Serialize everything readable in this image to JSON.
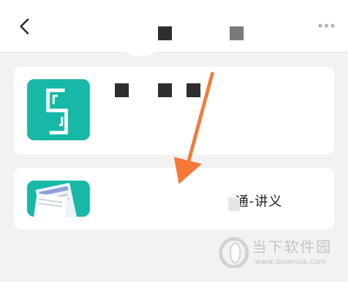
{
  "header": {
    "back_icon": "back-chevron-icon",
    "more_icon": "more-dots-icon"
  },
  "cards": [
    {
      "icon": "s-logo-app-icon",
      "icon_color": "#17b9a6"
    },
    {
      "icon": "document-app-icon",
      "icon_color": "#17b9a6",
      "title": "通-讲义"
    }
  ],
  "annotation": {
    "icon": "orange-arrow-pointer",
    "color": "#f57a3a"
  },
  "watermark": {
    "name": "当下软件园",
    "url": "www.downxia.com"
  }
}
